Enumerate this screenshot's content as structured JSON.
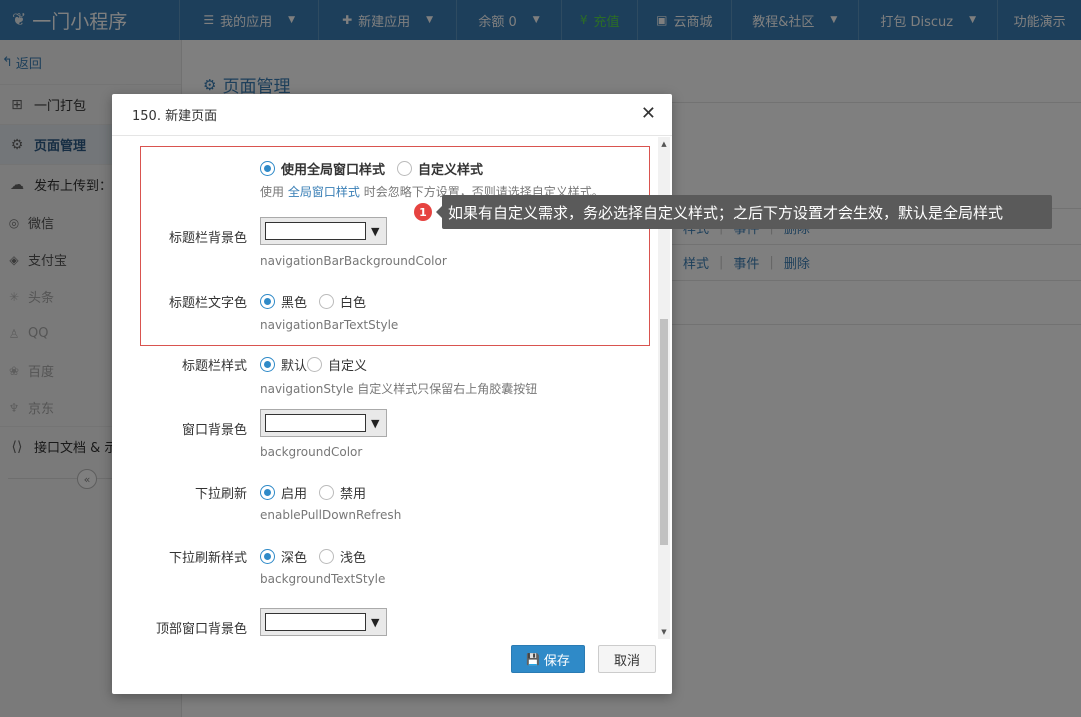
{
  "brand": {
    "name": "一门小程序"
  },
  "nav": [
    {
      "label": "我的应用",
      "icon": "list-icon",
      "caret": true
    },
    {
      "label": "新建应用",
      "icon": "plus-icon",
      "caret": true
    },
    {
      "label": "余额 0",
      "caret": true
    },
    {
      "label": "充值",
      "icon": "yuan-icon",
      "highlight": "#56d84e"
    },
    {
      "label": "云商城",
      "icon": "shop-icon"
    },
    {
      "label": "教程&社区",
      "caret": true
    },
    {
      "label": "打包 Discuz",
      "caret": true
    },
    {
      "label": "功能演示"
    }
  ],
  "sidebar": {
    "back": "返回",
    "items": [
      {
        "label": "一门打包",
        "icon": "grid-icon"
      },
      {
        "label": "页面管理",
        "icon": "page-gear-icon",
        "active": true
      },
      {
        "label": "发布上传到：",
        "icon": "cloud-upload-icon"
      }
    ],
    "subs": [
      {
        "label": "微信",
        "icon": "wechat-icon"
      },
      {
        "label": "支付宝",
        "icon": "alipay-icon"
      },
      {
        "label": "头条",
        "icon": "toutiao-icon",
        "dim": true
      },
      {
        "label": "QQ",
        "icon": "qq-icon",
        "dim": true
      },
      {
        "label": "百度",
        "icon": "baidu-icon",
        "dim": true
      },
      {
        "label": "京东",
        "icon": "jd-icon",
        "dim": true
      }
    ],
    "api_docs": "接口文档 & 示"
  },
  "main": {
    "title": "页面管理",
    "rows": [
      {
        "style": "样式",
        "event": "事件",
        "delete": "删除"
      },
      {
        "style": "样式",
        "event": "事件",
        "delete": "删除"
      }
    ]
  },
  "modal": {
    "title": "150. 新建页面",
    "window_style": {
      "options": [
        "使用全局窗口样式",
        "自定义样式"
      ],
      "selected": 0,
      "help_prefix": "使用",
      "help_link": "全局窗口样式",
      "help_suffix": "时会忽略下方设置，否则请选择自定义样式。"
    },
    "nav_bg": {
      "label": "标题栏背景色",
      "help": "navigationBarBackgroundColor",
      "value": "#ffffff"
    },
    "nav_text": {
      "label": "标题栏文字色",
      "options": [
        "黑色",
        "白色"
      ],
      "selected": 0,
      "help": "navigationBarTextStyle"
    },
    "nav_style": {
      "label": "标题栏样式",
      "options": [
        "默认",
        "自定义"
      ],
      "selected": 0,
      "help": "navigationStyle 自定义样式只保留右上角胶囊按钮"
    },
    "win_bg": {
      "label": "窗口背景色",
      "help": "backgroundColor",
      "value": "#ffffff"
    },
    "pull_refresh": {
      "label": "下拉刷新",
      "options": [
        "启用",
        "禁用"
      ],
      "selected": 0,
      "help": "enablePullDownRefresh"
    },
    "pull_style": {
      "label": "下拉刷新样式",
      "options": [
        "深色",
        "浅色"
      ],
      "selected": 0,
      "help": "backgroundTextStyle"
    },
    "top_bg": {
      "label": "顶部窗口背景色",
      "value": "#ffffff"
    },
    "save": "保存",
    "cancel": "取消"
  },
  "tooltip": {
    "badge": "1",
    "text": "如果有自定义需求，务必选择自定义样式；之后下方设置才会生效，默认是全局样式"
  },
  "colors": {
    "primary": "#2f8ac8",
    "nav_bg": "#3a7fb6",
    "tooltip_bg": "#5a5a5a",
    "badge": "#e64340",
    "highlight_box": "#d9534f"
  }
}
